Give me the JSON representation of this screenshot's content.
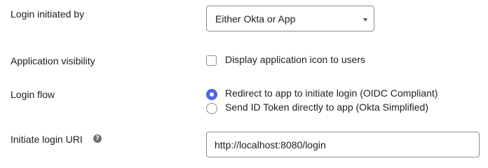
{
  "login_initiated_by": {
    "label": "Login initiated by",
    "selected": "Either Okta or App"
  },
  "application_visibility": {
    "label": "Application visibility",
    "checkbox_label": "Display application icon to users",
    "checked": false
  },
  "login_flow": {
    "label": "Login flow",
    "options": [
      {
        "label": "Redirect to app to initiate login (OIDC Compliant)",
        "selected": true
      },
      {
        "label": "Send ID Token directly to app (Okta Simplified)",
        "selected": false
      }
    ]
  },
  "initiate_login_uri": {
    "label": "Initiate login URI",
    "help_icon": "?",
    "value": "http://localhost:8080/login"
  },
  "colors": {
    "accent": "#4c64e1",
    "border": "#8c8c96",
    "text": "#1d1d21"
  }
}
